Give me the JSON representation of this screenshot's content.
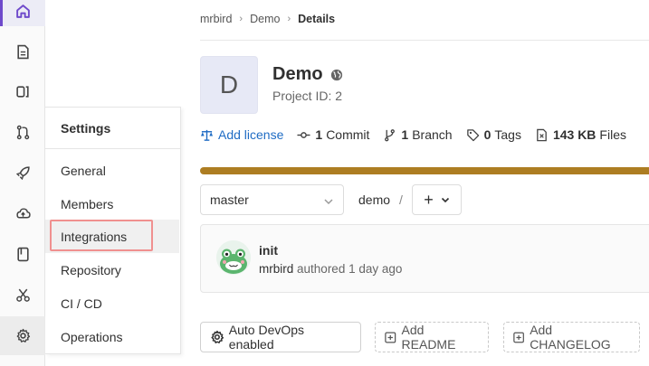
{
  "rail": {
    "items": [
      {
        "icon": "home-icon"
      },
      {
        "icon": "document-icon"
      },
      {
        "icon": "issues-icon"
      },
      {
        "icon": "merge-request-icon"
      },
      {
        "icon": "rocket-icon"
      },
      {
        "icon": "cloud-icon"
      },
      {
        "icon": "book-icon"
      },
      {
        "icon": "scissors-icon"
      },
      {
        "icon": "gear-icon"
      }
    ]
  },
  "settings_menu": {
    "title": "Settings",
    "items": [
      "General",
      "Members",
      "Integrations",
      "Repository",
      "CI / CD",
      "Operations"
    ]
  },
  "breadcrumb": {
    "items": [
      "mrbird",
      "Demo",
      "Details"
    ]
  },
  "project": {
    "avatar_letter": "D",
    "name": "Demo",
    "id_text": "Project ID: 2"
  },
  "stats": {
    "add_license": "Add license",
    "commits_count": "1",
    "commits_label": "Commit",
    "branches_count": "1",
    "branches_label": "Branch",
    "tags_count": "0",
    "tags_label": "Tags",
    "files_size": "143 KB",
    "files_label": "Files"
  },
  "language_bar": {
    "color": "#ad7d22",
    "fraction": 1.0
  },
  "repo": {
    "branch": "master",
    "path": "demo",
    "path_sep": "/",
    "add_symbol": "+"
  },
  "commit": {
    "title": "init",
    "author": "mrbird",
    "meta": "authored 1 day ago"
  },
  "actions": {
    "auto_devops": "Auto DevOps enabled",
    "add_readme": "Add README",
    "add_changelog": "Add CHANGELOG"
  },
  "colors": {
    "accent": "#6e49cb",
    "link": "#1f6cc4",
    "highlight_outline": "#f0908f"
  }
}
